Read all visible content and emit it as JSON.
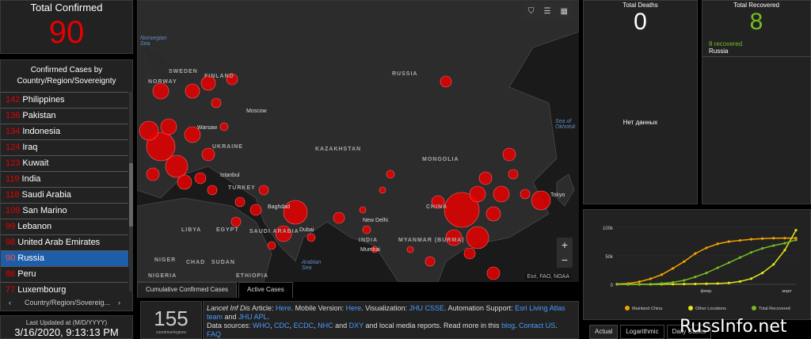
{
  "total": {
    "label": "Total Confirmed",
    "value": "90"
  },
  "list": {
    "header": "Confirmed Cases by Country/Region/Sovereignty",
    "rows": [
      {
        "n": "142",
        "name": "Philippines"
      },
      {
        "n": "136",
        "name": "Pakistan"
      },
      {
        "n": "134",
        "name": "Indonesia"
      },
      {
        "n": "124",
        "name": "Iraq"
      },
      {
        "n": "123",
        "name": "Kuwait"
      },
      {
        "n": "119",
        "name": "India"
      },
      {
        "n": "118",
        "name": "Saudi Arabia"
      },
      {
        "n": "109",
        "name": "San Marino"
      },
      {
        "n": "99",
        "name": "Lebanon"
      },
      {
        "n": "98",
        "name": "United Arab Emirates"
      },
      {
        "n": "90",
        "name": "Russia",
        "selected": true
      },
      {
        "n": "86",
        "name": "Peru"
      },
      {
        "n": "77",
        "name": "Luxembourg"
      }
    ],
    "nav_label": "Country/Region/Sovereig..."
  },
  "updated": {
    "label": "Last Updated at (M/D/YYYY)",
    "value": "3/16/2020, 9:13:13 PM"
  },
  "map": {
    "labels": {
      "russia": "RUSSIA",
      "sweden": "SWEDEN",
      "finland": "FINLAND",
      "norway": "NORWAY",
      "ukraine": "UKRAINE",
      "turkey": "TURKEY",
      "kazakhstan": "KAZAKHSTAN",
      "mongolia": "MONGOLIA",
      "china": "CHINA",
      "india": "INDIA",
      "libya": "LIBYA",
      "egypt": "EGYPT",
      "saudi": "SAUDI ARABIA",
      "niger": "NIGER",
      "chad": "CHAD",
      "sudan": "SUDAN",
      "nigeria": "NIGERIA",
      "ethiopia": "ETHIOPIA",
      "myanmar": "MYANMAR (BURMA)",
      "norwegian_sea": "Norwegian Sea",
      "okhotsk": "Sea of Okhotsk",
      "arabian_sea": "Arabian Sea",
      "moscow": "Moscow",
      "istanbul": "Istanbul",
      "new_delhi": "New Delhi",
      "dubai": "Dubai",
      "mumbai": "Mumbai",
      "warsaw": "Warsaw",
      "tokyo": "Tokyo",
      "baghdad": "Baghdad"
    },
    "attribution": "Esri, FAO, NOAA",
    "zoom_in": "+",
    "zoom_out": "−",
    "tabs": [
      "Cumulative Confirmed Cases",
      "Active Cases"
    ]
  },
  "countries": {
    "value": "155",
    "label": "countries/regions"
  },
  "info": {
    "t1": "Lancet Inf Dis",
    "t2": " Article: ",
    "here1": "Here",
    "t3": ". Mobile Version: ",
    "here2": "Here",
    "t4": ". Visualization: ",
    "jhu_csse": "JHU CSSE",
    "t5": ". Automation Support: ",
    "esri": "Esri Living Atlas team",
    "t6": " and ",
    "jhu_apl": "JHU APL",
    "t7": ".",
    "t8": "Data sources: ",
    "who": "WHO",
    "cdc": "CDC",
    "ecdc": "ECDC",
    "nhc": "NHC",
    "t9": " and ",
    "dxy": "DXY",
    "t10": " and local media reports. Read more in this ",
    "blog": "blog",
    "t11": ". ",
    "contact": "Contact US",
    "t12": ".",
    "faq": "FAQ"
  },
  "deaths": {
    "label": "Total Deaths",
    "value": "0",
    "no_data": "Нет данных"
  },
  "recovered": {
    "label": "Total Recovered",
    "value": "8",
    "sub_value": "8 recovered",
    "sub_country": "Russia"
  },
  "chart_data": {
    "type": "line",
    "x_tick_labels": [
      "февр.",
      "март"
    ],
    "y_ticks": [
      "0",
      "50k",
      "100k"
    ],
    "ylim": [
      0,
      100000
    ],
    "series": [
      {
        "name": "Mainland China",
        "color": "#f5a300",
        "values": [
          550,
          1500,
          4500,
          9700,
          17000,
          28000,
          40000,
          54000,
          64000,
          71000,
          75000,
          77000,
          79000,
          80200,
          80900,
          81000,
          81050
        ]
      },
      {
        "name": "Other Locations",
        "color": "#e5e51a",
        "values": [
          0,
          0,
          10,
          50,
          150,
          300,
          500,
          700,
          1000,
          1500,
          2500,
          5000,
          10000,
          20000,
          35000,
          60000,
          95000
        ]
      },
      {
        "name": "Total Recovered",
        "color": "#77bb22",
        "values": [
          0,
          20,
          100,
          500,
          1500,
          3500,
          7000,
          13000,
          20000,
          29000,
          38000,
          47000,
          56000,
          63000,
          68000,
          72000,
          78000
        ]
      }
    ],
    "legend_position": "bottom",
    "tabs": [
      "Actual",
      "Logarithmic",
      "Daily Cases"
    ]
  },
  "watermark": "RussInfo.net"
}
